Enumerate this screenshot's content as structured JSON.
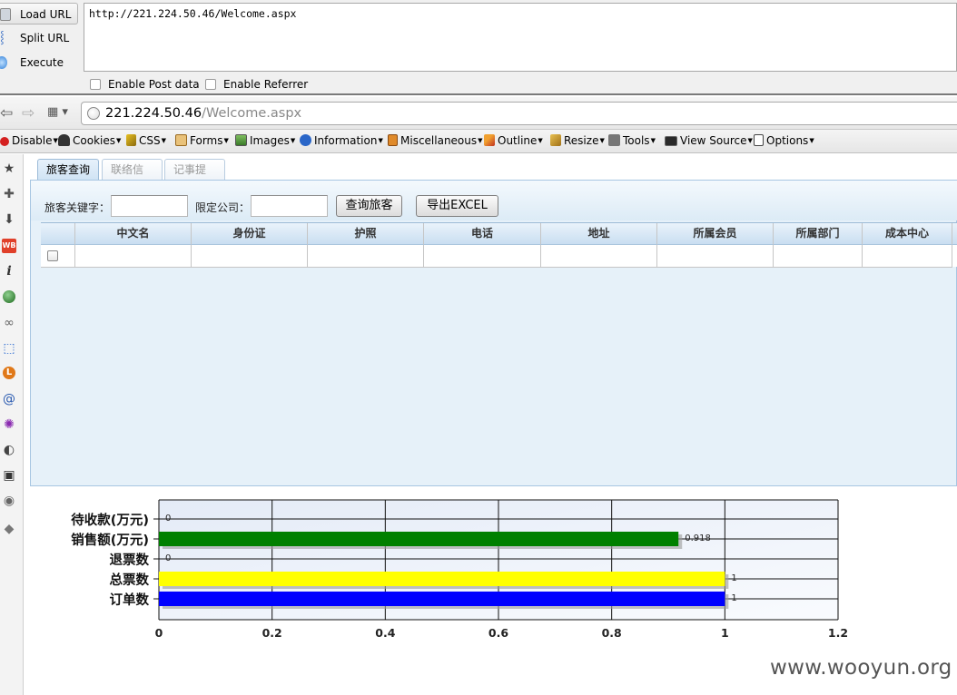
{
  "hackbar": {
    "load_url_label": "Load URL",
    "split_url_label": "Split URL",
    "execute_label": "Execute",
    "url_value": "http://221.224.50.46/Welcome.aspx",
    "enable_post_label": "Enable Post data",
    "enable_referrer_label": "Enable Referrer"
  },
  "navbar": {
    "address_host": "221.224.50.46",
    "address_path": "/Welcome.aspx"
  },
  "devbar": {
    "items": [
      "Disable",
      "Cookies",
      "CSS",
      "Forms",
      "Images",
      "Information",
      "Miscellaneous",
      "Outline",
      "Resize",
      "Tools",
      "View Source",
      "Options"
    ],
    "icons": [
      "disable-icon",
      "cookies-icon",
      "css-icon",
      "forms-icon",
      "images-icon",
      "information-icon",
      "miscellaneous-icon",
      "outline-icon",
      "resize-icon",
      "tools-icon",
      "view-source-icon",
      "options-icon"
    ]
  },
  "sidebar": {
    "icons": [
      "bookmark-star-icon",
      "addons-puzzle-icon",
      "download-arrow-icon",
      "weibo-icon",
      "info-icon",
      "green-circle-icon",
      "link-chain-icon",
      "inspect-cursor-icon",
      "l-circle-icon",
      "swirl-icon",
      "bug-icon",
      "palette-icon",
      "layout-icon",
      "globe-icon",
      "eraser-icon"
    ]
  },
  "tabs": [
    {
      "label": "旅客查询",
      "active": true
    },
    {
      "label": "联络信息",
      "active": false
    },
    {
      "label": "记事提醒",
      "active": false
    }
  ],
  "search": {
    "keyword_label": "旅客关键字：",
    "keyword_value": "",
    "company_label": "限定公司：",
    "company_value": "",
    "query_button": "查询旅客",
    "export_button": "导出EXCEL"
  },
  "grid": {
    "columns": [
      "中文名",
      "身份证",
      "护照",
      "电话",
      "地址",
      "所属会员",
      "所属部门",
      "成本中心"
    ],
    "rows": [
      [
        "",
        "",
        "",
        "",
        "",
        "",
        "",
        ""
      ]
    ]
  },
  "chart_data": {
    "type": "bar",
    "orientation": "horizontal",
    "categories": [
      "待收款(万元)",
      "销售额(万元)",
      "退票数",
      "总票数",
      "订单数"
    ],
    "values": [
      0,
      0.918,
      0,
      1,
      1
    ],
    "value_labels": [
      "0",
      "0.918",
      "0",
      "1",
      "1"
    ],
    "colors": [
      "#008000",
      "#008000",
      "#008000",
      "#ffff00",
      "#0000ff"
    ],
    "xticks": [
      "0",
      "0.2",
      "0.4",
      "0.6",
      "0.8",
      "1",
      "1.2"
    ],
    "xlim": [
      0,
      1.2
    ],
    "grid": true,
    "title": "",
    "xlabel": "",
    "ylabel": ""
  },
  "watermark": "www.wooyun.org"
}
